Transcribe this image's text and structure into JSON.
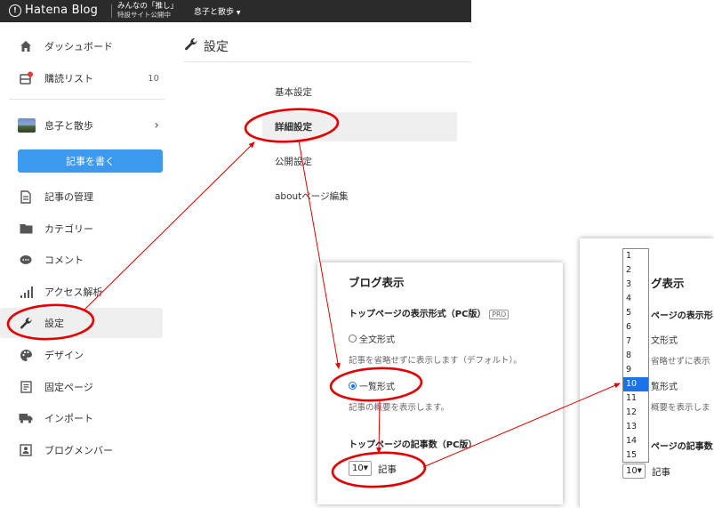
{
  "topbar": {
    "brand": "Hatena Blog",
    "campaign_line1": "みんなの「推し」",
    "campaign_line2": "特設サイト公開中",
    "blog_switcher": "息子と散歩"
  },
  "sidebar": {
    "dashboard": "ダッシュボード",
    "subscriptions": "購読リスト",
    "subscriptions_count": "10",
    "blog_name": "息子と散歩",
    "write_button": "記事を書く",
    "items": [
      {
        "label": "記事の管理",
        "icon": "document-icon"
      },
      {
        "label": "カテゴリー",
        "icon": "folder-icon"
      },
      {
        "label": "コメント",
        "icon": "comment-icon"
      },
      {
        "label": "アクセス解析",
        "icon": "bar-chart-icon"
      },
      {
        "label": "設定",
        "icon": "wrench-icon"
      },
      {
        "label": "デザイン",
        "icon": "palette-icon"
      },
      {
        "label": "固定ページ",
        "icon": "pages-icon"
      },
      {
        "label": "インポート",
        "icon": "truck-icon"
      },
      {
        "label": "ブログメンバー",
        "icon": "members-icon"
      }
    ]
  },
  "main": {
    "title": "設定",
    "tabs": [
      "基本設定",
      "詳細設定",
      "公開設定",
      "aboutページ編集"
    ]
  },
  "panel": {
    "heading": "ブログ表示",
    "format_label": "トップページの表示形式（PC版）",
    "pro_badge": "PRO",
    "option_full": "全文形式",
    "option_full_desc": "記事を省略せずに表示します（デフォルト）。",
    "option_list": "一覧形式",
    "option_list_desc": "記事の概要を表示します。",
    "count_label": "トップページの記事数（PC版）",
    "count_value": "10",
    "count_unit": "記事"
  },
  "panel_zoom": {
    "heading_partial": "グ表示",
    "format_partial": "ページの表示形",
    "full_partial": "文形式",
    "full_desc_partial": "省略せずに表示",
    "list_partial": "覧形式",
    "list_desc_partial": "概要を表示しま",
    "count_partial": "ページの記事数",
    "select_value": "10",
    "unit": "記事",
    "dropdown_options": [
      "1",
      "2",
      "3",
      "4",
      "5",
      "6",
      "7",
      "8",
      "9",
      "10",
      "11",
      "12",
      "13",
      "14",
      "15"
    ],
    "dropdown_selected": "10"
  },
  "colors": {
    "accent": "#3c99ee",
    "annotation": "#e30000",
    "topbar": "#2b2b2b"
  }
}
